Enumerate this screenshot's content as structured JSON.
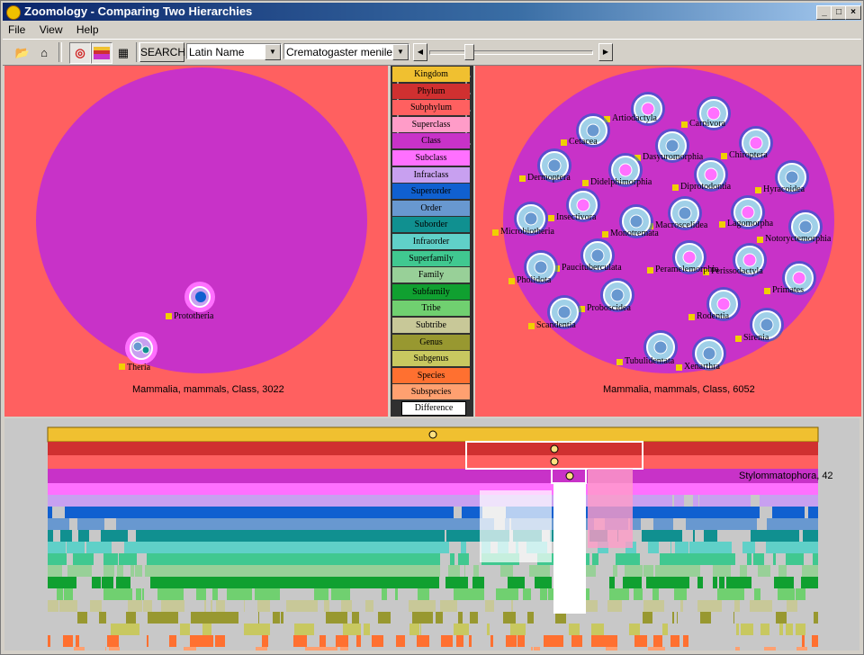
{
  "window": {
    "title": "Zoomology - Comparing Two Hierarchies",
    "controls": {
      "minimize": "_",
      "maximize": "□",
      "close": "×"
    }
  },
  "menu": [
    "File",
    "View",
    "Help"
  ],
  "toolbar": {
    "search_label": "SEARCH",
    "name_mode": "Latin Name",
    "search_value": "Crematogaster menilekii",
    "slider_value": 0.2
  },
  "left_tree": {
    "caption": "Mammalia, mammals, Class, 3022",
    "nodes": [
      {
        "label": "Prototheria",
        "children": 1
      },
      {
        "label": "Theria",
        "children": 3
      }
    ]
  },
  "right_tree": {
    "caption": "Mammalia, mammals, Class, 6052",
    "nodes": [
      {
        "label": "Artiodactyla"
      },
      {
        "label": "Carnivora"
      },
      {
        "label": "Cetacea"
      },
      {
        "label": "Chiroptera"
      },
      {
        "label": "Dasyuromorphia"
      },
      {
        "label": "Dermoptera"
      },
      {
        "label": "Didelphimorphia"
      },
      {
        "label": "Diprotodontia"
      },
      {
        "label": "Hyracoidea"
      },
      {
        "label": "Insectivora"
      },
      {
        "label": "Lagomorpha"
      },
      {
        "label": "Macroscelidea"
      },
      {
        "label": "Microbiotheria"
      },
      {
        "label": "Monotremata"
      },
      {
        "label": "Notoryctemorphia"
      },
      {
        "label": "Paucituberculata"
      },
      {
        "label": "Peramelemorphia"
      },
      {
        "label": "Perissodactyla"
      },
      {
        "label": "Pholidota"
      },
      {
        "label": "Primates"
      },
      {
        "label": "Proboscidea"
      },
      {
        "label": "Rodentia"
      },
      {
        "label": "Scandentia"
      },
      {
        "label": "Sirenia"
      },
      {
        "label": "Tubulidentata"
      },
      {
        "label": "Xenarthra"
      }
    ]
  },
  "legend": [
    {
      "label": "Kingdom",
      "color": "#f0c030"
    },
    {
      "label": "Phylum",
      "color": "#d03030"
    },
    {
      "label": "Subphylum",
      "color": "#ff6060"
    },
    {
      "label": "Superclass",
      "color": "#ff9cc8"
    },
    {
      "label": "Class",
      "color": "#c832c8"
    },
    {
      "label": "Subclass",
      "color": "#ff70ff"
    },
    {
      "label": "Infraclass",
      "color": "#c8a0f0"
    },
    {
      "label": "Superorder",
      "color": "#1060d0"
    },
    {
      "label": "Order",
      "color": "#6898d0"
    },
    {
      "label": "Suborder",
      "color": "#109090"
    },
    {
      "label": "Infraorder",
      "color": "#60d0c8"
    },
    {
      "label": "Superfamily",
      "color": "#40c890"
    },
    {
      "label": "Family",
      "color": "#98d098"
    },
    {
      "label": "Subfamily",
      "color": "#10a030"
    },
    {
      "label": "Tribe",
      "color": "#70d070"
    },
    {
      "label": "Subtribe",
      "color": "#c8c898"
    },
    {
      "label": "Genus",
      "color": "#989830"
    },
    {
      "label": "Subgenus",
      "color": "#c8c860"
    },
    {
      "label": "Species",
      "color": "#ff7030"
    },
    {
      "label": "Subspecies",
      "color": "#ffa070"
    },
    {
      "label": "Difference",
      "color": "#ffffff"
    }
  ],
  "tooltip": "Stylommatophora, 42"
}
